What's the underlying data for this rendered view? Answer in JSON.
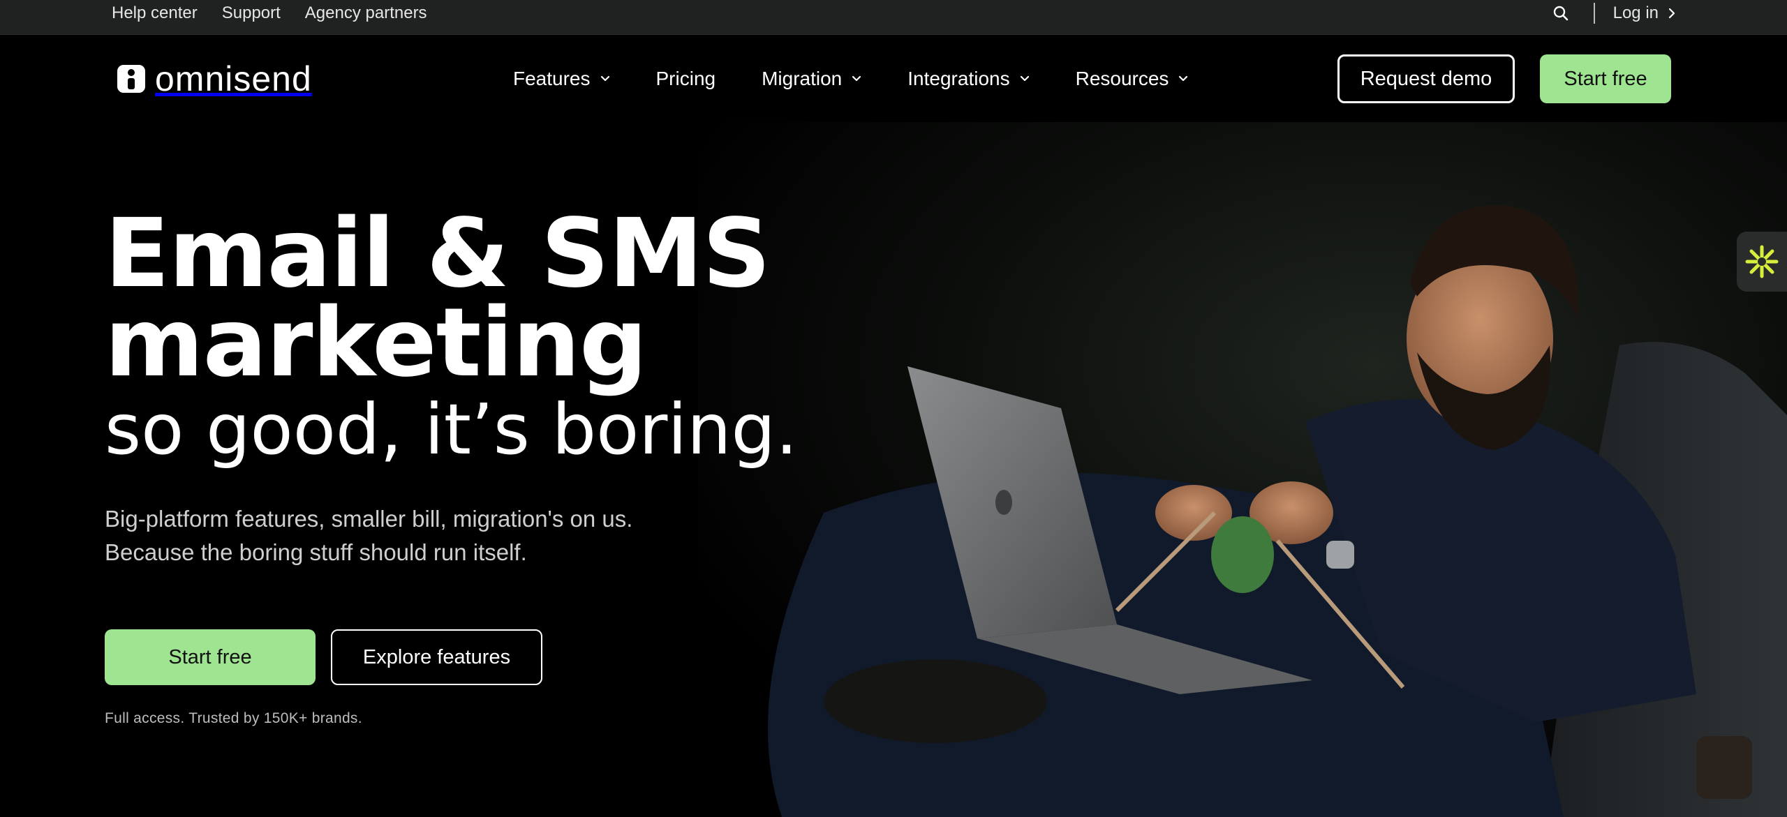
{
  "utility_bar": {
    "links": [
      "Help center",
      "Support",
      "Agency partners"
    ],
    "login_label": "Log in",
    "search_icon": "search-icon"
  },
  "nav": {
    "logo_text": "omnisend",
    "items": [
      {
        "label": "Features",
        "has_dropdown": true
      },
      {
        "label": "Pricing",
        "has_dropdown": false
      },
      {
        "label": "Migration",
        "has_dropdown": true
      },
      {
        "label": "Integrations",
        "has_dropdown": true
      },
      {
        "label": "Resources",
        "has_dropdown": true
      }
    ],
    "request_demo_label": "Request demo",
    "start_free_label": "Start free"
  },
  "hero": {
    "headline_line1": "Email & SMS",
    "headline_line2": "marketing",
    "subhead": "so good, it’s boring.",
    "description_line1": "Big-platform features, smaller bill, migration's on us.",
    "description_line2": "Because the boring stuff should run itself.",
    "primary_cta": "Start free",
    "secondary_cta": "Explore features",
    "note": "Full access. Trusted by 150K+ brands."
  },
  "colors": {
    "accent_green": "#9fe591",
    "background": "#000000",
    "utility_bar": "#202221",
    "widget_icon": "#d7ee3c"
  }
}
